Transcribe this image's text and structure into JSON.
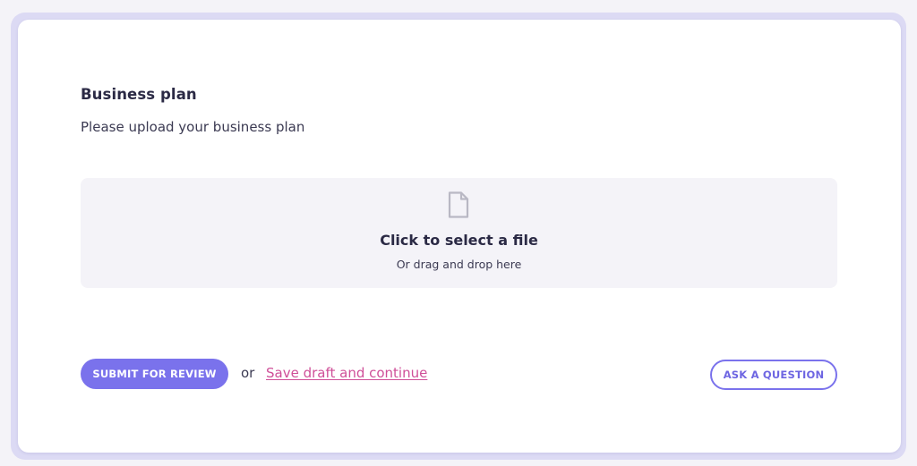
{
  "section": {
    "title": "Business plan",
    "description": "Please upload your business plan"
  },
  "upload": {
    "icon": "file-icon",
    "title": "Click to select a file",
    "subtitle": "Or drag and drop here"
  },
  "actions": {
    "submit_label": "SUBMIT FOR REVIEW",
    "or_text": "or",
    "draft_link": "Save draft and continue",
    "ask_label": "ASK A QUESTION"
  },
  "colors": {
    "accent": "#7a72ec",
    "link": "#cf4f98",
    "text": "#2b2a45",
    "dropzone_bg": "#f4f3f8"
  }
}
